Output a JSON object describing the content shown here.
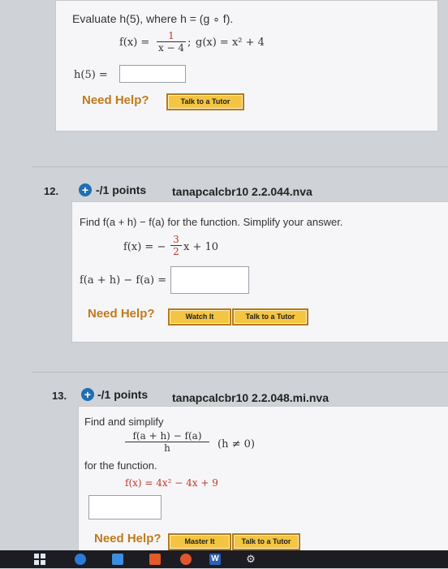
{
  "q11": {
    "prompt": "Evaluate h(5), where h = (g ∘ f).",
    "f_lhs": "f(x) =",
    "f_num": "1",
    "f_den": "x − 4",
    "g_text": "g(x) = x² + 4",
    "answer_label": "h(5) =",
    "need_help": "Need Help?",
    "talk_tutor": "Talk to a Tutor"
  },
  "q12": {
    "number": "12.",
    "points": "-/1 points",
    "code": "tanapcalcbr10 2.2.044.nva",
    "prompt": "Find f(a + h) − f(a) for the function. Simplify your answer.",
    "f_lhs": "f(x) = −",
    "f_num": "3",
    "f_den": "2",
    "f_rest": "x + 10",
    "answer_label": "f(a + h) − f(a) =",
    "need_help": "Need Help?",
    "watch_it": "Watch It",
    "talk_tutor": "Talk to a Tutor"
  },
  "q13": {
    "number": "13.",
    "points": "-/1 points",
    "code": "tanapcalcbr10 2.2.048.mi.nva",
    "prompt": "Find and simplify",
    "frac_num": "f(a + h) − f(a)",
    "frac_den": "h",
    "condition": "(h ≠ 0)",
    "for_function": "for the function.",
    "f_text": "f(x) = 4x² − 4x + 9",
    "need_help": "Need Help?",
    "master_it": "Master It",
    "talk_tutor": "Talk to a Tutor"
  },
  "taskbar": {
    "icons": [
      "windows-start-icon",
      "edge-browser-icon",
      "store-icon",
      "office-icon",
      "media-icon",
      "word-icon",
      "settings-icon"
    ],
    "word_label": "W"
  },
  "colors": {
    "plus": "#1f6fb2",
    "need_help": "#c07a1a",
    "button_fill": "#f4c542",
    "button_border": "#b37a1e",
    "red_value": "#c0392b"
  }
}
